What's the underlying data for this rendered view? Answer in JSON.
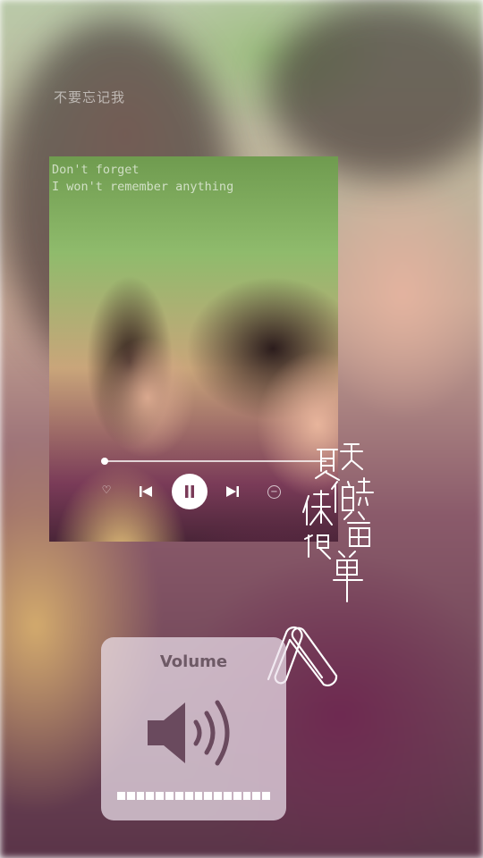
{
  "background": {
    "caption": "不要忘记我"
  },
  "player": {
    "lyrics_line1": "Don't forget ",
    "lyrics_line2": "I won't remember anything ",
    "progress": 0.03,
    "controls": {
      "like_icon": "heart-icon",
      "prev_icon": "skip-previous-icon",
      "play_icon": "pause-icon",
      "next_icon": "skip-next-icon",
      "remove_icon": "minus-circle-icon"
    }
  },
  "calligraphy": {
    "text": "夏天的快乐简单很"
  },
  "volume_hud": {
    "title": "Volume",
    "icon": "speaker-icon",
    "level": 1.0,
    "segments": 16
  },
  "colors": {
    "hud_background": "#ebe1eb",
    "hud_text": "#6e5a66",
    "icon_tint": "#6a4a5e"
  }
}
